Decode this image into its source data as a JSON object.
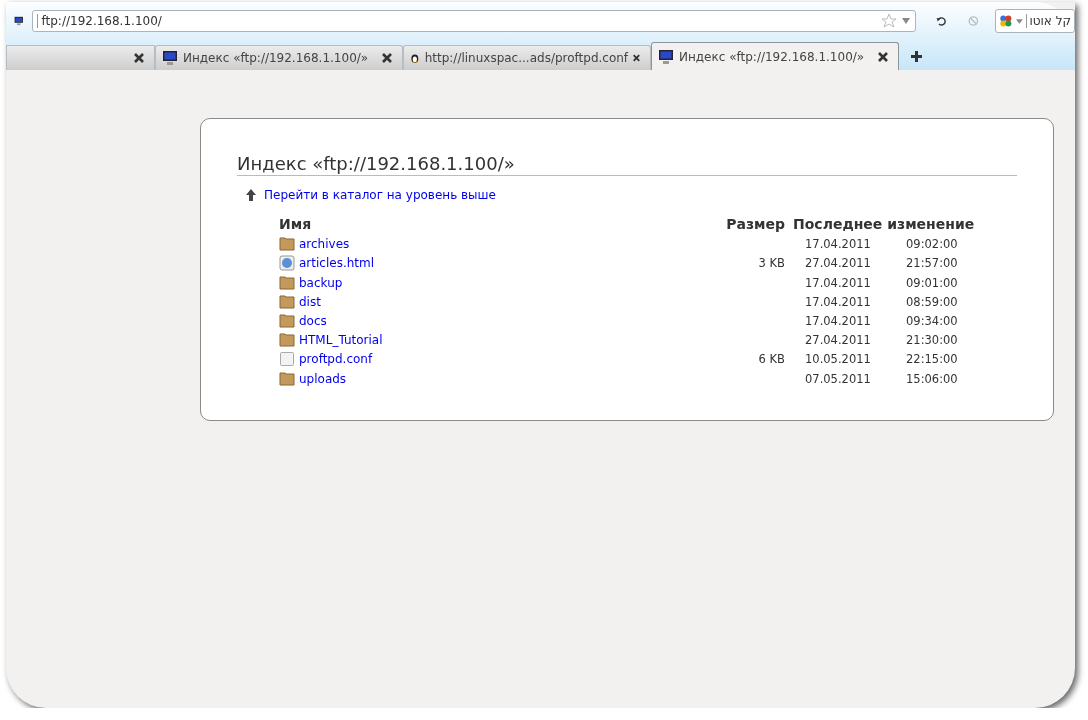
{
  "address_bar": {
    "value": "ftp://192.168.1.100/",
    "bookmarked": false
  },
  "search_box": {
    "value": "קל אוטו"
  },
  "tabs": [
    {
      "kind": "blank",
      "selected": false
    },
    {
      "kind": "local",
      "label": "Индекс «ftp://192.168.1.100/»",
      "selected": false
    },
    {
      "kind": "linux",
      "label": "http://linuxspac...ads/proftpd.conf",
      "selected": false
    },
    {
      "kind": "local",
      "label": "Индекс «ftp://192.168.1.100/»",
      "selected": true
    }
  ],
  "page": {
    "title": "Индекс «ftp://192.168.1.100/»",
    "up_link": "Перейти в каталог на уровень выше",
    "columns": [
      "Имя",
      "Размер",
      "Последнее изменение"
    ],
    "rows": [
      {
        "kind": "folder",
        "name": "archives",
        "size": "",
        "date": "17.04.2011",
        "time": "09:02:00"
      },
      {
        "kind": "web",
        "name": "articles.html",
        "size": "3 KB",
        "date": "27.04.2011",
        "time": "21:57:00"
      },
      {
        "kind": "folder",
        "name": "backup",
        "size": "",
        "date": "17.04.2011",
        "time": "09:01:00"
      },
      {
        "kind": "folder",
        "name": "dist",
        "size": "",
        "date": "17.04.2011",
        "time": "08:59:00"
      },
      {
        "kind": "folder",
        "name": "docs",
        "size": "",
        "date": "17.04.2011",
        "time": "09:34:00"
      },
      {
        "kind": "folder",
        "name": "HTML_Tutorial",
        "size": "",
        "date": "27.04.2011",
        "time": "21:30:00"
      },
      {
        "kind": "file",
        "name": "proftpd.conf",
        "size": "6 KB",
        "date": "10.05.2011",
        "time": "22:15:00"
      },
      {
        "kind": "folder",
        "name": "uploads",
        "size": "",
        "date": "07.05.2011",
        "time": "15:06:00"
      }
    ]
  }
}
